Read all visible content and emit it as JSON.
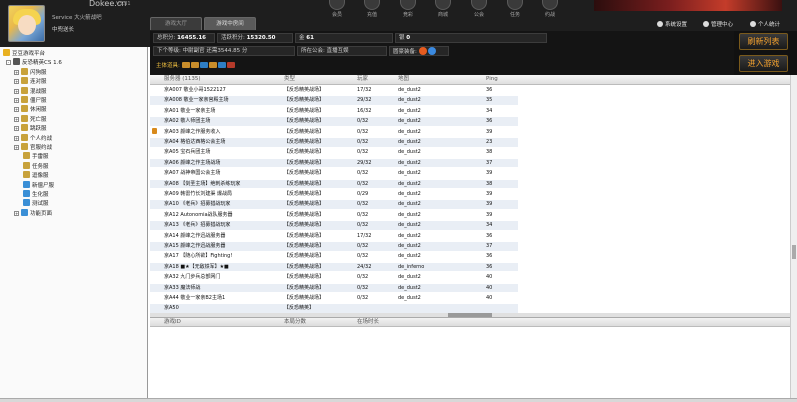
{
  "header": {
    "brand_name": "Dokee.cn",
    "brand_version": "V3.31",
    "user_line1": "Service 大火箭战吧",
    "user_line2": "中兜送长",
    "tabs": [
      "游戏大厅",
      "游戏中房间"
    ],
    "nav": [
      "会员",
      "充值",
      "竞彩",
      "商城",
      "公会",
      "任务",
      "约战"
    ],
    "tools": [
      "系统设置",
      "管理中心",
      "个人统计"
    ]
  },
  "sidebar": {
    "items": [
      {
        "label": "豆豆游戏平台",
        "level": 0,
        "expander": "",
        "color": "#e8b020"
      },
      {
        "label": "反恐精英CS 1.6",
        "level": 1,
        "expander": "-",
        "color": "#555555"
      },
      {
        "label": "闪狗服",
        "level": 2,
        "expander": "+",
        "color": "#c8a23b"
      },
      {
        "label": "连对服",
        "level": 2,
        "expander": "+",
        "color": "#c8a23b"
      },
      {
        "label": "混战服",
        "level": 2,
        "expander": "+",
        "color": "#c8a23b"
      },
      {
        "label": "僵尸服",
        "level": 2,
        "expander": "+",
        "color": "#c8a23b"
      },
      {
        "label": "休闲服",
        "level": 2,
        "expander": "+",
        "color": "#c8a23b"
      },
      {
        "label": "死亡服",
        "level": 2,
        "expander": "+",
        "color": "#c8a23b"
      },
      {
        "label": "跳跃服",
        "level": 2,
        "expander": "+",
        "color": "#c8a23b"
      },
      {
        "label": "个人约战",
        "level": 2,
        "expander": "+",
        "color": "#c8a23b"
      },
      {
        "label": "官服约战",
        "level": 2,
        "expander": "+",
        "color": "#c8a23b"
      },
      {
        "label": "手雷服",
        "level": 2,
        "expander": "",
        "color": "#c8a23b"
      },
      {
        "label": "任务服",
        "level": 2,
        "expander": "",
        "color": "#c8a23b"
      },
      {
        "label": "逗像服",
        "level": 2,
        "expander": "",
        "color": "#c8a23b"
      },
      {
        "label": "新僵尸服",
        "level": 2,
        "expander": "",
        "color": "#3a8fd6"
      },
      {
        "label": "生化服",
        "level": 2,
        "expander": "",
        "color": "#3a8fd6"
      },
      {
        "label": "测试服",
        "level": 2,
        "expander": "",
        "color": "#3a8fd6"
      },
      {
        "label": "功能页面",
        "level": 2,
        "expander": "+",
        "color": "#3a8fd6"
      }
    ]
  },
  "infobar": {
    "total_points_label": "总积分:",
    "total_points": "16455.16",
    "active_points_label": "活跃积分:",
    "active_points": "15320.50",
    "gold_label": "金",
    "gold_count": "61",
    "coin_label": "银",
    "coin_count": "0",
    "next_level_label": "下个等级:",
    "next_level_value": "中尉副官 还需3544.85 分",
    "guild_label": "所在公会:",
    "guild_value": "直播互娱",
    "guild_items_label": "圆豪装备:",
    "tools_label": "主体道具:"
  },
  "buttons": {
    "refresh": "刷新列表",
    "enter": "进入游戏"
  },
  "server_list": {
    "columns": [
      "服务器 (1135)",
      "类型",
      "玩家",
      "地图",
      "Ping"
    ],
    "rows": [
      {
        "name": "京A007 敬业小哥1522127",
        "type": "【反恐精英战场】",
        "players": "17/32",
        "map": "de_dust2",
        "ping": "36",
        "locked": false
      },
      {
        "name": "京A008 敬业一家亲宫殿主场",
        "type": "【反恐精英战场】",
        "players": "29/32",
        "map": "de_dust2",
        "ping": "35",
        "locked": false
      },
      {
        "name": "京A01 敬业一家亲主场",
        "type": "【反恐精英战场】",
        "players": "16/32",
        "map": "de_dust2",
        "ping": "34",
        "locked": false
      },
      {
        "name": "京A02 敬人师团主场",
        "type": "【反恐精英战场】",
        "players": "0/32",
        "map": "de_dust2",
        "ping": "36",
        "locked": false
      },
      {
        "name": "京A03 颜峰之作服务收入",
        "type": "【反恐精英战场】",
        "players": "0/32",
        "map": "de_dust2",
        "ping": "39",
        "locked": true
      },
      {
        "name": "京A04 格伯达西格公会主场",
        "type": "【反恐精英战场】",
        "players": "0/32",
        "map": "de_dust2",
        "ping": "23",
        "locked": false
      },
      {
        "name": "京A05 宝石兵团主场",
        "type": "【反恐精英战场】",
        "players": "0/32",
        "map": "de_dust2",
        "ping": "38",
        "locked": false
      },
      {
        "name": "京A06 颜峰之作主场战场",
        "type": "【反恐精英战场】",
        "players": "29/32",
        "map": "de_dust2",
        "ping": "37",
        "locked": false
      },
      {
        "name": "京A07 战神帝国公会主场",
        "type": "【反恐精英战场】",
        "players": "0/32",
        "map": "de_dust2",
        "ping": "39",
        "locked": false
      },
      {
        "name": "京A08 【剑圣主场】绝刺杀练玩家",
        "type": "【反恐精英战场】",
        "players": "0/32",
        "map": "de_dust2",
        "ping": "38",
        "locked": false
      },
      {
        "name": "京A09 韩雷竹长刘建渠 爆战局",
        "type": "【反恐精英战场】",
        "players": "0/29",
        "map": "de_dust2",
        "ping": "39",
        "locked": false
      },
      {
        "name": "京A10 《老兵》招募猎战玩家",
        "type": "【反恐精英战场】",
        "players": "0/32",
        "map": "de_dust2",
        "ping": "39",
        "locked": false
      },
      {
        "name": "京A12 Autonomia战队服务器",
        "type": "【反恐精英战场】",
        "players": "0/32",
        "map": "de_dust2",
        "ping": "39",
        "locked": false
      },
      {
        "name": "京A13 《老兵》招募猎战玩家",
        "type": "【反恐精英战场】",
        "players": "0/32",
        "map": "de_dust2",
        "ping": "34",
        "locked": false
      },
      {
        "name": "京A14 颜峰之作迅战服务器",
        "type": "【反恐精英战场】",
        "players": "17/32",
        "map": "de_dust2",
        "ping": "36",
        "locked": false
      },
      {
        "name": "京A15 颜峰之作迅战服务器",
        "type": "【反恐精英战场】",
        "players": "0/32",
        "map": "de_dust2",
        "ping": "37",
        "locked": false
      },
      {
        "name": "京A17 【随心所欲】Fighting!",
        "type": "【反恐精英战场】",
        "players": "0/32",
        "map": "de_dust2",
        "ping": "36",
        "locked": false
      },
      {
        "name": "京A18 ■★【无敌铁军】★■",
        "type": "【反恐精英战场】",
        "players": "24/32",
        "map": "de_inferno",
        "ping": "36",
        "locked": false
      },
      {
        "name": "京A32 九门步兵总部网门",
        "type": "【反恐精英战场】",
        "players": "0/32",
        "map": "de_dust2",
        "ping": "40",
        "locked": false
      },
      {
        "name": "京A33 魔法师战",
        "type": "【反恐精英战场】",
        "players": "0/32",
        "map": "de_dust2",
        "ping": "40",
        "locked": false
      },
      {
        "name": "京A44 敬业一家亲B2主场1",
        "type": "【反恐精英战场】",
        "players": "0/32",
        "map": "de_dust2",
        "ping": "40",
        "locked": false
      },
      {
        "name": "京A50",
        "type": "【反恐精英】",
        "players": "",
        "map": "",
        "ping": "",
        "locked": false
      }
    ]
  },
  "detail": {
    "columns": [
      "游戏ID",
      "本局分数",
      "在场时长"
    ]
  }
}
